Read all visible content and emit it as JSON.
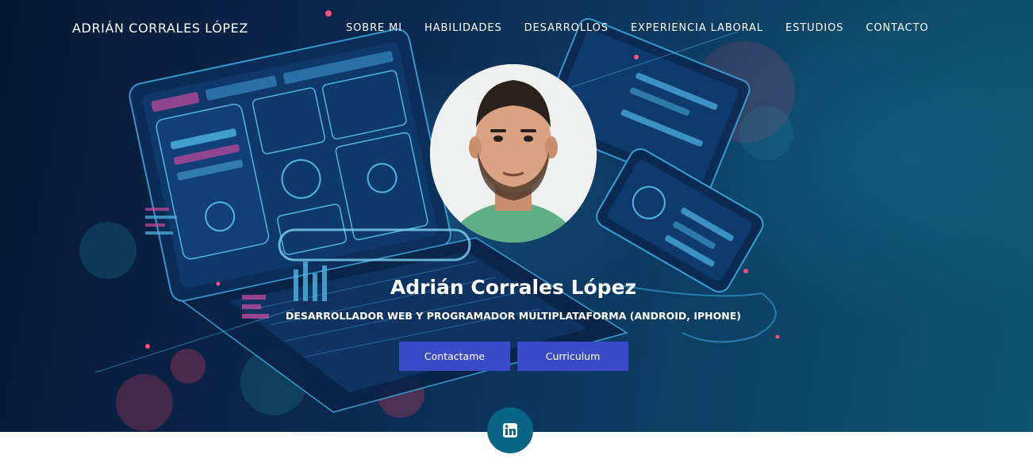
{
  "header": {
    "brand": "ADRIÁN CORRALES LÓPEZ",
    "nav": [
      {
        "label": "SOBRE MI"
      },
      {
        "label": "HABILIDADES"
      },
      {
        "label": "DESARROLLOS"
      },
      {
        "label": "EXPERIENCIA LABORAL"
      },
      {
        "label": "ESTUDIOS"
      },
      {
        "label": "CONTACTO"
      }
    ]
  },
  "hero": {
    "name": "Adrián Corrales López",
    "tagline": "DESARROLLADOR WEB Y PROGRAMADOR MULTIPLATAFORMA (ANDROID, IPHONE)",
    "buttons": {
      "contact": "Contactame",
      "cv": "Curriculum"
    }
  },
  "social": {
    "icon": "linkedin-icon"
  },
  "colors": {
    "hero_dark": "#061833",
    "hero_teal": "#0d5470",
    "button": "#3b4ac6",
    "social": "#0a6483",
    "text": "#ffffff"
  }
}
